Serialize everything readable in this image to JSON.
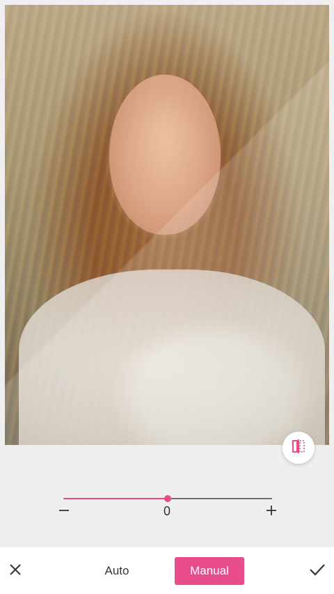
{
  "editor": {
    "slider": {
      "value_label": "0",
      "fill_fraction": 0.5
    },
    "compare": {
      "icon": "compare-split-icon"
    },
    "controls": {
      "minus_icon": "minus-icon",
      "plus_icon": "plus-icon"
    }
  },
  "bottom_bar": {
    "close_icon": "close-icon",
    "auto_label": "Auto",
    "manual_label": "Manual",
    "confirm_icon": "checkmark-icon"
  },
  "colors": {
    "accent": "#e84c8b",
    "background": "#efefef",
    "bar": "#ffffff"
  }
}
